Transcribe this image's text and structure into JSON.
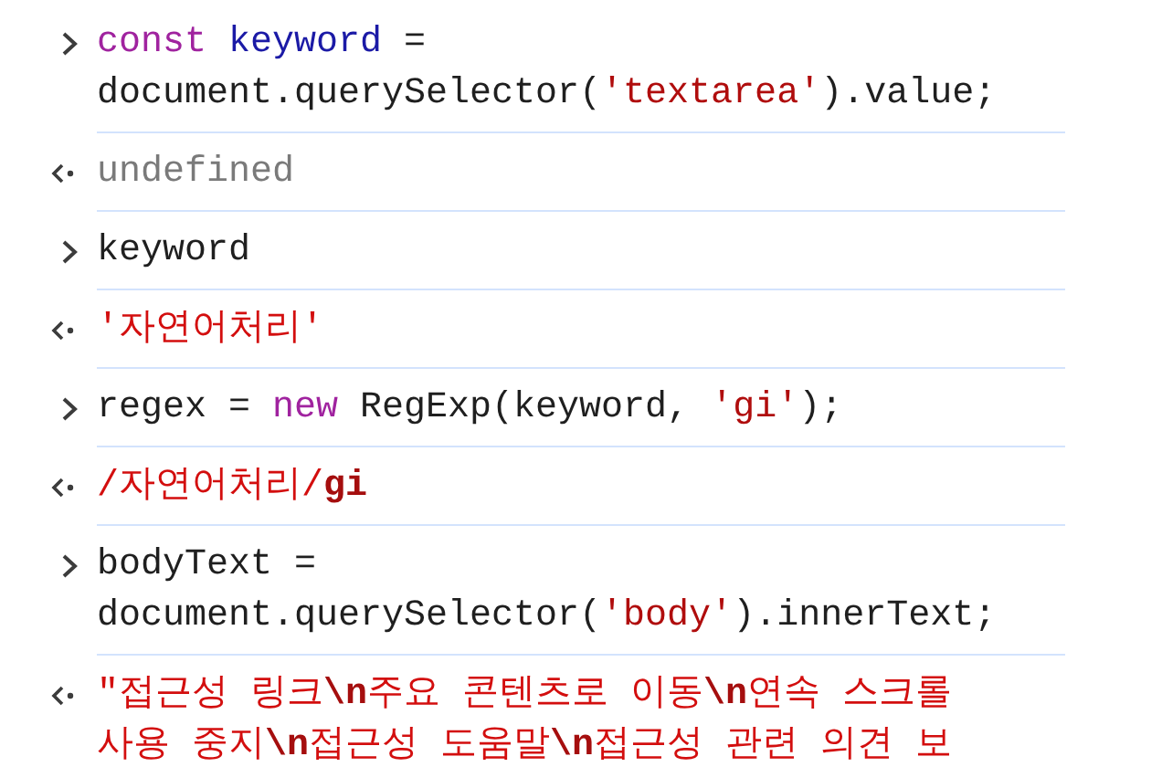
{
  "console": {
    "entries": [
      {
        "kind": "input",
        "lines": [
          [
            {
              "text": "const ",
              "kind": "keyword"
            },
            {
              "text": "keyword",
              "kind": "variable"
            },
            {
              "text": " =",
              "kind": "plain"
            }
          ],
          [
            {
              "text": "document.querySelector(",
              "kind": "plain"
            },
            {
              "text": "'textarea'",
              "kind": "string"
            },
            {
              "text": ").value;",
              "kind": "plain"
            }
          ]
        ]
      },
      {
        "kind": "output",
        "lines": [
          [
            {
              "text": "undefined",
              "kind": "undefined"
            }
          ]
        ]
      },
      {
        "kind": "input",
        "lines": [
          [
            {
              "text": "keyword",
              "kind": "plain"
            }
          ]
        ]
      },
      {
        "kind": "output",
        "lines": [
          [
            {
              "text": "'자연어처리'",
              "kind": "result"
            }
          ]
        ]
      },
      {
        "kind": "input",
        "lines": [
          [
            {
              "text": "regex = ",
              "kind": "plain"
            },
            {
              "text": "new",
              "kind": "keyword"
            },
            {
              "text": " RegExp(keyword, ",
              "kind": "plain"
            },
            {
              "text": "'gi'",
              "kind": "string"
            },
            {
              "text": ");",
              "kind": "plain"
            }
          ]
        ]
      },
      {
        "kind": "output",
        "lines": [
          [
            {
              "text": "/자연어처리/",
              "kind": "result"
            },
            {
              "text": "gi",
              "kind": "flag"
            }
          ]
        ]
      },
      {
        "kind": "input",
        "lines": [
          [
            {
              "text": "bodyText =",
              "kind": "plain"
            }
          ],
          [
            {
              "text": "document.querySelector(",
              "kind": "plain"
            },
            {
              "text": "'body'",
              "kind": "string"
            },
            {
              "text": ").innerText;",
              "kind": "plain"
            }
          ]
        ]
      },
      {
        "kind": "output",
        "lines": [
          [
            {
              "text": "\"접근성 링크",
              "kind": "result"
            },
            {
              "text": "\\n",
              "kind": "escape"
            },
            {
              "text": "주요 콘텐츠로 이동",
              "kind": "result"
            },
            {
              "text": "\\n",
              "kind": "escape"
            },
            {
              "text": "연속 스크롤",
              "kind": "result"
            }
          ],
          [
            {
              "text": "사용 중지",
              "kind": "result"
            },
            {
              "text": "\\n",
              "kind": "escape"
            },
            {
              "text": "접근성 도움말",
              "kind": "result"
            },
            {
              "text": "\\n",
              "kind": "escape"
            },
            {
              "text": "접근성 관련 의견 보",
              "kind": "result"
            }
          ]
        ]
      }
    ]
  }
}
